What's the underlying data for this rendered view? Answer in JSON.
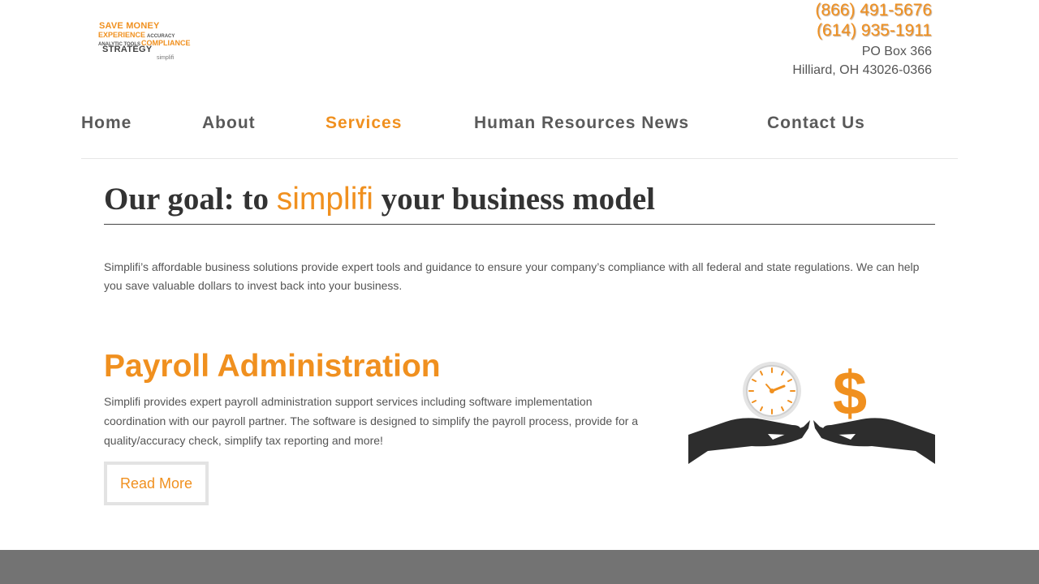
{
  "logo": {
    "line1": "SAVE MONEY",
    "line2": "EXPERIENCE",
    "line2b": "ACCURACY",
    "line3": "ANALYTIC TOOLS",
    "line3b": "COMPLIANCE",
    "line4": "STRATEGY",
    "line5": "simplifi"
  },
  "contact": {
    "phone1": "(866) 491-5676",
    "phone2": "(614) 935-1911",
    "address1": "PO Box 366",
    "address2": "Hilliard, OH 43026-0366"
  },
  "nav": {
    "items": [
      {
        "label": "Home"
      },
      {
        "label": "About"
      },
      {
        "label": "Services"
      },
      {
        "label": "Human Resources News"
      },
      {
        "label": "Contact Us"
      }
    ],
    "active": "Services"
  },
  "hero": {
    "prefix": "Our goal: to ",
    "highlight": "simplifi",
    "suffix": " your business model",
    "intro": "Simplifi’s affordable business solutions provide expert tools and guidance to ensure your company’s compliance with all federal and state regulations. We can help you save valuable dollars to invest back into your business."
  },
  "payroll": {
    "title": "Payroll Administration",
    "description": "Simplifi provides expert payroll administration support services including software implementation coordination with our payroll partner. The software is designed to simplify the payroll process, provide for a quality/accuracy check, simplify tax reporting and more!",
    "button": "Read More",
    "image_icon_left": "clock-icon",
    "image_icon_right": "dollar-icon",
    "image_symbol": "$"
  },
  "colors": {
    "accent": "#f0901f",
    "text": "#333333",
    "footer": "#737373"
  }
}
